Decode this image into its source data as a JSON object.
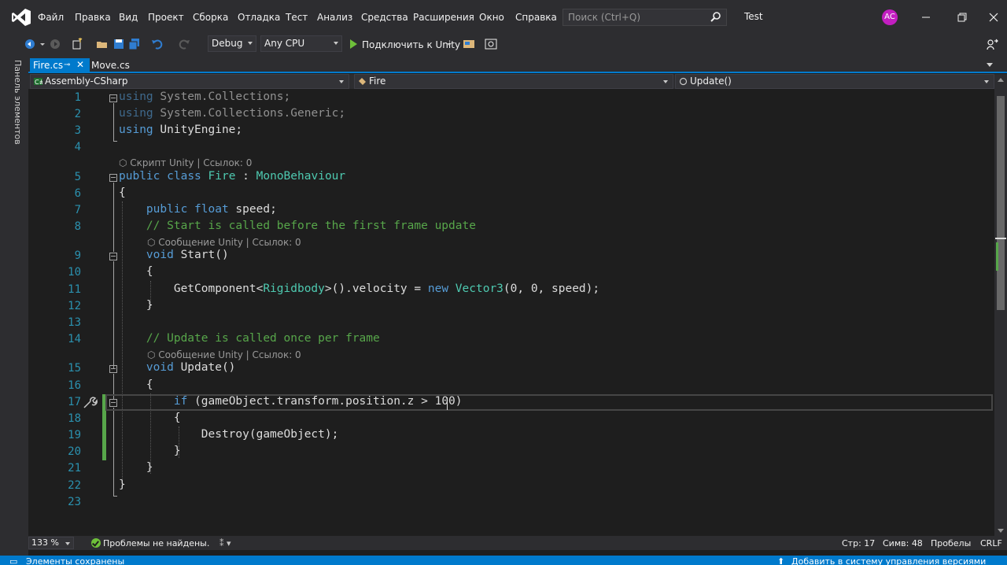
{
  "menu": [
    "Файл",
    "Правка",
    "Вид",
    "Проект",
    "Сборка",
    "Отладка",
    "Тест",
    "Анализ",
    "Средства",
    "Расширения",
    "Окно",
    "Справка"
  ],
  "search": {
    "placeholder": "Поиск (Ctrl+Q)"
  },
  "solution_name": "Test",
  "user_initials": "AC",
  "toolbar": {
    "configuration": "Debug",
    "platform": "Any CPU",
    "attach_label": "Подключить к Unity"
  },
  "side_panel": {
    "label": "Панель элементов"
  },
  "tabs": [
    {
      "label": "Fire.cs",
      "active": true
    },
    {
      "label": "Move.cs",
      "active": false
    }
  ],
  "nav": {
    "project": "Assembly-CSharp",
    "type": "Fire",
    "member": "Update()"
  },
  "code": {
    "line_numbers": [
      "1",
      "2",
      "3",
      "4",
      "5",
      "6",
      "7",
      "8",
      "9",
      "10",
      "11",
      "12",
      "13",
      "14",
      "15",
      "16",
      "17",
      "18",
      "19",
      "20",
      "21",
      "22",
      "23"
    ],
    "lines": [
      {
        "parts": [
          {
            "t": "using",
            "c": "using-dim"
          },
          {
            "t": " System.Collections;",
            "c": "ns-dim"
          }
        ]
      },
      {
        "parts": [
          {
            "t": "using",
            "c": "using-dim"
          },
          {
            "t": " System.Collections.Generic;",
            "c": "ns-dim"
          }
        ]
      },
      {
        "parts": [
          {
            "t": "using",
            "c": "kw"
          },
          {
            "t": " UnityEngine;",
            "c": ""
          }
        ]
      },
      {
        "parts": []
      },
      {
        "parts": [
          {
            "t": "public",
            "c": "kw"
          },
          {
            "t": " ",
            "c": ""
          },
          {
            "t": "class",
            "c": "kw"
          },
          {
            "t": " ",
            "c": ""
          },
          {
            "t": "Fire",
            "c": "ty"
          },
          {
            "t": " : ",
            "c": ""
          },
          {
            "t": "MonoBehaviour",
            "c": "ty"
          }
        ]
      },
      {
        "parts": [
          {
            "t": "{",
            "c": ""
          }
        ]
      },
      {
        "parts": [
          {
            "t": "    ",
            "c": ""
          },
          {
            "t": "public",
            "c": "kw"
          },
          {
            "t": " ",
            "c": ""
          },
          {
            "t": "float",
            "c": "kw"
          },
          {
            "t": " speed;",
            "c": ""
          }
        ]
      },
      {
        "parts": [
          {
            "t": "    ",
            "c": ""
          },
          {
            "t": "// Start is called before the first frame update",
            "c": "cm"
          }
        ]
      },
      {
        "parts": [
          {
            "t": "    ",
            "c": ""
          },
          {
            "t": "void",
            "c": "kw"
          },
          {
            "t": " Start()",
            "c": ""
          }
        ]
      },
      {
        "parts": [
          {
            "t": "    {",
            "c": ""
          }
        ]
      },
      {
        "parts": [
          {
            "t": "        GetComponent<",
            "c": ""
          },
          {
            "t": "Rigidbody",
            "c": "ty"
          },
          {
            "t": ">().velocity = ",
            "c": ""
          },
          {
            "t": "new",
            "c": "kw"
          },
          {
            "t": " ",
            "c": ""
          },
          {
            "t": "Vector3",
            "c": "ty"
          },
          {
            "t": "(0, 0, speed);",
            "c": ""
          }
        ]
      },
      {
        "parts": [
          {
            "t": "    }",
            "c": ""
          }
        ]
      },
      {
        "parts": []
      },
      {
        "parts": [
          {
            "t": "    ",
            "c": ""
          },
          {
            "t": "// Update is called once per frame",
            "c": "cm"
          }
        ]
      },
      {
        "parts": [
          {
            "t": "    ",
            "c": ""
          },
          {
            "t": "void",
            "c": "kw"
          },
          {
            "t": " Update()",
            "c": ""
          }
        ]
      },
      {
        "parts": [
          {
            "t": "    {",
            "c": ""
          }
        ]
      },
      {
        "parts": [
          {
            "t": "        ",
            "c": ""
          },
          {
            "t": "if",
            "c": "kw"
          },
          {
            "t": " (gameObject.transform.position.z > 100)",
            "c": ""
          }
        ]
      },
      {
        "parts": [
          {
            "t": "        {",
            "c": ""
          }
        ]
      },
      {
        "parts": [
          {
            "t": "            Destroy(gameObject);",
            "c": ""
          }
        ]
      },
      {
        "parts": [
          {
            "t": "        }",
            "c": ""
          }
        ]
      },
      {
        "parts": [
          {
            "t": "    }",
            "c": ""
          }
        ]
      },
      {
        "parts": [
          {
            "t": "}",
            "c": ""
          }
        ]
      },
      {
        "parts": []
      }
    ],
    "codelens": {
      "class": "Скрипт Unity | Ссылок: 0",
      "start": "Сообщение Unity | Ссылок: 0",
      "update": "Сообщение Unity | Ссылок: 0"
    }
  },
  "infobar": {
    "zoom": "133 %",
    "problems": "Проблемы не найдены.",
    "line": "Стр: 17",
    "column": "Симв: 48",
    "whitespace": "Пробелы",
    "line_ending": "CRLF"
  },
  "status": {
    "left": "Элементы сохранены",
    "right": "Добавить в систему управления версиями"
  },
  "colors": {
    "accent": "#007acc",
    "keyword": "#569cd6",
    "type": "#4ec9b0",
    "comment": "#57a64a",
    "line_number": "#2b91af",
    "avatar": "#c21ec0"
  },
  "icons": [
    "vs-logo-icon",
    "search-icon",
    "minimize-icon",
    "restore-icon",
    "close-icon",
    "back-icon",
    "forward-icon",
    "new-project-icon",
    "open-folder-icon",
    "save-icon",
    "save-all-icon",
    "undo-icon",
    "redo-icon",
    "play-icon",
    "unity-icon",
    "screenshot-icon",
    "pin-icon",
    "csharp-icon",
    "class-icon",
    "method-icon",
    "quick-action-icon",
    "checkmark-icon",
    "source-control-icon",
    "live-share-icon"
  ]
}
